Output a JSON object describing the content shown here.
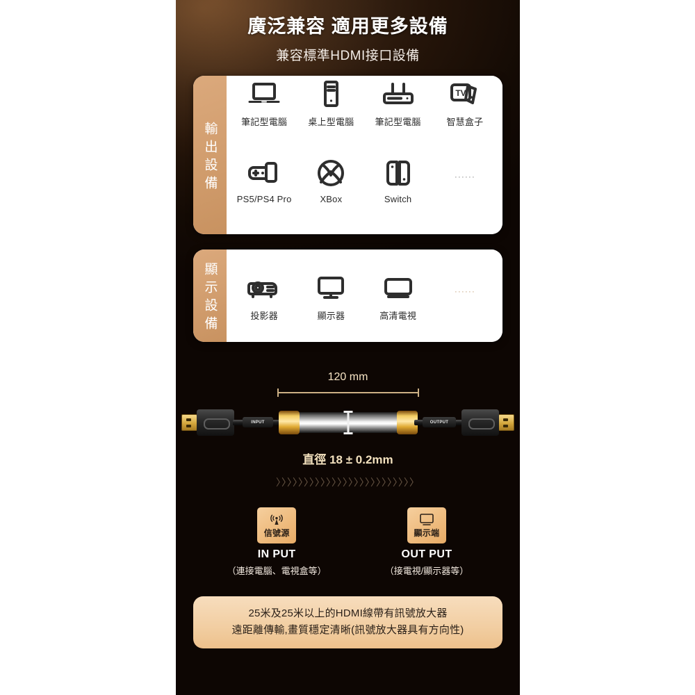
{
  "header": {
    "title": "廣泛兼容 適用更多設備",
    "subtitle": "兼容標準HDMI接口設備"
  },
  "output_section": {
    "label": "輸出設備",
    "row1": [
      {
        "icon": "laptop-icon",
        "label": "筆記型電腦"
      },
      {
        "icon": "desktop-tower-icon",
        "label": "桌上型電腦"
      },
      {
        "icon": "router-icon",
        "label": "筆記型電腦"
      },
      {
        "icon": "tv-box-icon",
        "label": "智慧盒子"
      }
    ],
    "row2": [
      {
        "icon": "playstation-controller-icon",
        "label": "PS5/PS4 Pro"
      },
      {
        "icon": "xbox-icon",
        "label": "XBox"
      },
      {
        "icon": "switch-icon",
        "label": "Switch"
      }
    ],
    "more_dots": "······"
  },
  "display_section": {
    "label": "顯示設備",
    "items": [
      {
        "icon": "projector-icon",
        "label": "投影器"
      },
      {
        "icon": "monitor-icon",
        "label": "顯示器"
      },
      {
        "icon": "hdtv-icon",
        "label": "高清電視"
      }
    ],
    "more_dots": "······"
  },
  "cable_spec": {
    "length_label": "120 mm",
    "diameter_label": "直徑 18 ± 0.2mm",
    "input_tag": "INPUT",
    "output_tag": "OUTPUT",
    "chevrons": "〉〉〉〉〉〉〉〉〉〉〉〉〉〉〉〉〉〉〉〉〉〉〉〉〉"
  },
  "io_section": {
    "input": {
      "badge_icon": "signal-tower-icon",
      "badge_text": "信號源",
      "title": "IN PUT",
      "subtitle": "（連接電腦、電視盒等）"
    },
    "output": {
      "badge_icon": "monitor-icon",
      "badge_text": "顯示端",
      "title": "OUT PUT",
      "subtitle": "（接電視/顯示器等）"
    }
  },
  "note": {
    "line1": "25米及25米以上的HDMI線帶有訊號放大器",
    "line2": "遠距離傳輸,畫質穩定清晰(訊號放大器具有方向性)"
  },
  "colors": {
    "accent_orange": "#d39f70",
    "badge_orange": "#efbd81",
    "note_bg": "#f2cfa4",
    "panel_dark": "#120803",
    "gold": "#d4a73d"
  }
}
